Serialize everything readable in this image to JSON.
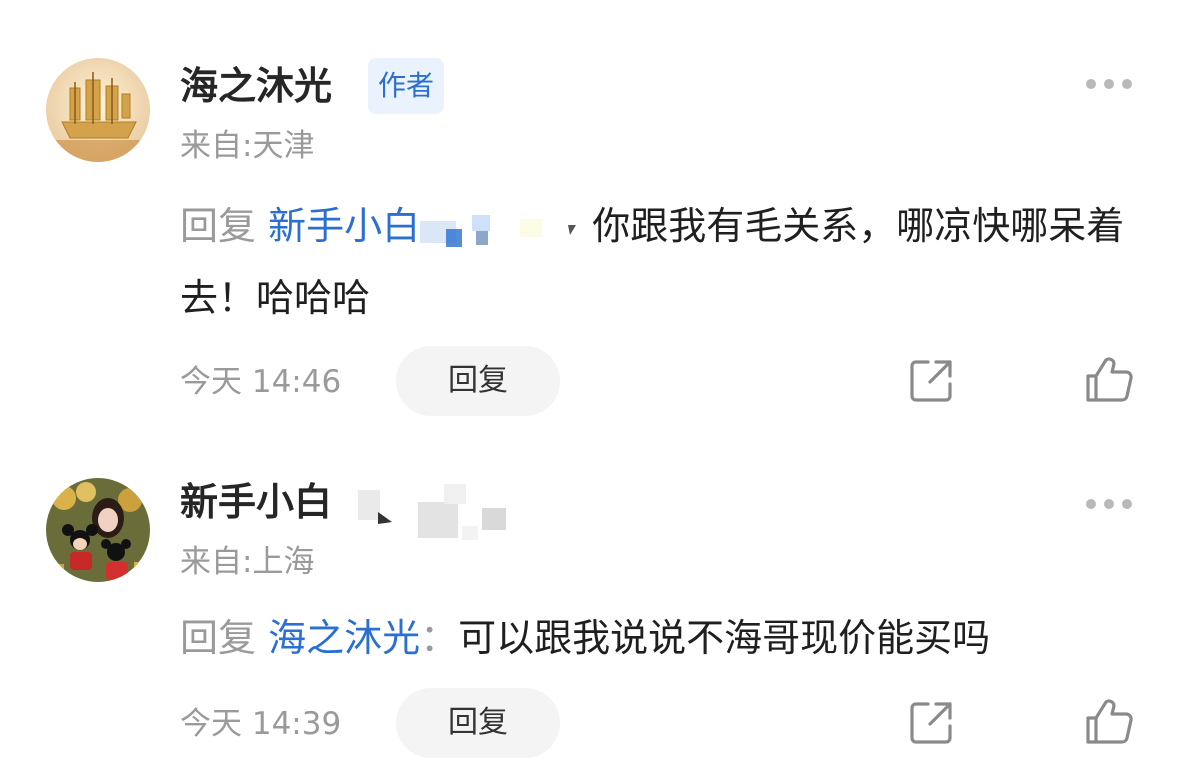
{
  "comments": [
    {
      "username": "海之沐光",
      "badge": "作者",
      "location": "来自:天津",
      "reply_prefix": "回复",
      "mention": "新手小白",
      "text": "你跟我有毛关系，哪凉快哪呆着去！哈哈哈",
      "time": "今天 14:46",
      "reply_button": "回复",
      "icons": [
        "more-icon",
        "share-icon",
        "like-icon"
      ]
    },
    {
      "username": "新手小白",
      "location": "来自:上海",
      "reply_prefix": "回复",
      "mention": "海之沐光",
      "separator": "：",
      "text": "可以跟我说说不海哥现价能买吗",
      "time": "今天 14:39",
      "reply_button": "回复",
      "icons": [
        "more-icon",
        "share-icon",
        "like-icon"
      ]
    }
  ],
  "colors": {
    "mention": "#2a6fd1",
    "badge_bg": "#eaf2fd",
    "muted": "#9a9a9a"
  }
}
